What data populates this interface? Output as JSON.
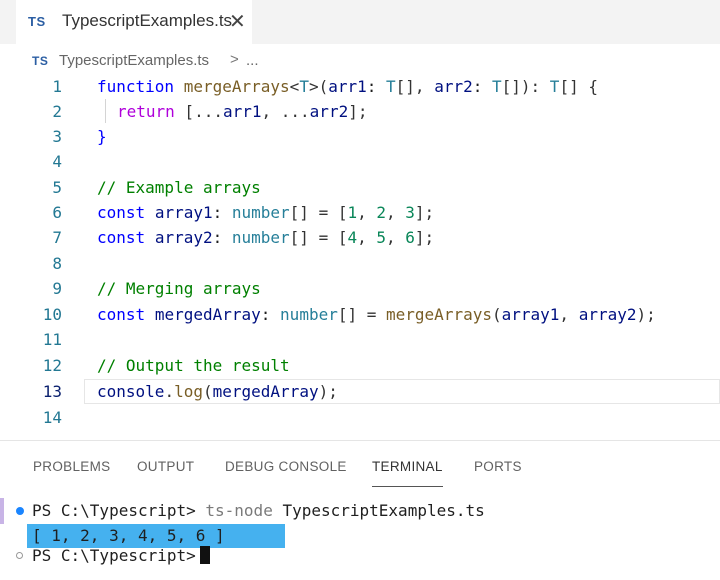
{
  "tab": {
    "badge": "TS",
    "filename": "TypescriptExamples.ts",
    "close_glyph": "✕"
  },
  "breadcrumb": {
    "badge": "TS",
    "file": "TypescriptExamples.ts",
    "separator": ">",
    "more": "..."
  },
  "editor": {
    "active_line": 13,
    "lines": [
      {
        "n": "1"
      },
      {
        "n": "2"
      },
      {
        "n": "3"
      },
      {
        "n": "4"
      },
      {
        "n": "5"
      },
      {
        "n": "6"
      },
      {
        "n": "7"
      },
      {
        "n": "8"
      },
      {
        "n": "9"
      },
      {
        "n": "10"
      },
      {
        "n": "11"
      },
      {
        "n": "12"
      },
      {
        "n": "13"
      },
      {
        "n": "14"
      }
    ],
    "code": {
      "l1": [
        "function",
        " ",
        "mergeArrays",
        "<",
        "T",
        ">(",
        "arr1",
        ": ",
        "T",
        "[], ",
        "arr2",
        ": ",
        "T",
        "[]): ",
        "T",
        "[] {"
      ],
      "l2": [
        "return",
        " [...",
        "arr1",
        ", ...",
        "arr2",
        "];"
      ],
      "l3": [
        "}"
      ],
      "l5": [
        "// Example arrays"
      ],
      "l6": [
        "const",
        " ",
        "array1",
        ": ",
        "number",
        "[] = [",
        "1",
        ", ",
        "2",
        ", ",
        "3",
        "];"
      ],
      "l7": [
        "const",
        " ",
        "array2",
        ": ",
        "number",
        "[] = [",
        "4",
        ", ",
        "5",
        ", ",
        "6",
        "];"
      ],
      "l9": [
        "// Merging arrays"
      ],
      "l10": [
        "const",
        " ",
        "mergedArray",
        ": ",
        "number",
        "[] = ",
        "mergeArrays",
        "(",
        "array1",
        ", ",
        "array2",
        ");"
      ],
      "l12": [
        "// Output the result"
      ],
      "l13": [
        "console",
        ".",
        "log",
        "(",
        "mergedArray",
        ");"
      ]
    }
  },
  "panel": {
    "tabs": [
      "PROBLEMS",
      "OUTPUT",
      "DEBUG CONSOLE",
      "TERMINAL",
      "PORTS"
    ],
    "active_tab": "TERMINAL"
  },
  "terminal": {
    "line1_prompt": "PS C:\\Typescript> ",
    "line1_cmd": "ts-node",
    "line1_arg": " TypescriptExamples.ts",
    "line2_output": "[ 1, 2, 3, 4, 5, 6 ]",
    "line3_prompt": "PS C:\\Typescript>"
  },
  "colors": {
    "keyword": "#0000ff",
    "control": "#af00db",
    "function": "#795e26",
    "variable": "#001080",
    "type": "#267f99",
    "number": "#098658",
    "comment": "#008000",
    "selection": "#45b1ef"
  },
  "icons": {
    "tab_close": "close-icon",
    "terminal_status_success": "circle-filled-icon",
    "terminal_status_idle": "circle-outline-icon"
  }
}
